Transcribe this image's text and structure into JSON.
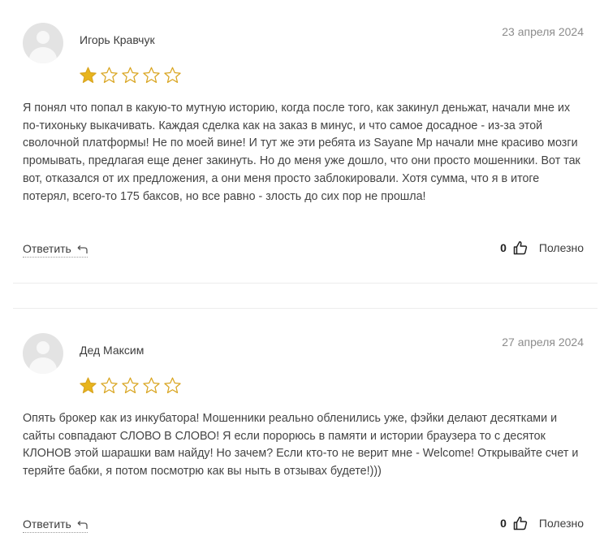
{
  "reviews": [
    {
      "author": "Игорь Кравчук",
      "date": "23 апреля 2024",
      "rating": 1,
      "max_rating": 5,
      "text": "Я понял что попал в какую-то мутную историю, когда после того, как закинул деньжат, начали мне их по-тихоньку выкачивать. Каждая сделка как на заказ в минус, и что самое досадное - из-за этой сволочной платформы! Не по моей вине! И тут же эти ребята из Sayane Mp начали мне красиво мозги промывать, предлагая еще денег закинуть. Но до меня уже дошло, что они просто мошенники. Вот так вот, отказался от их предложения, а они меня просто заблокировали. Хотя сумма, что я в итоге потерял, всего-то 175 баксов, но все равно - злость до сих пор не прошла!",
      "reply_label": "Ответить",
      "useful_count": "0",
      "useful_label": "Полезно"
    },
    {
      "author": "Дед Максим",
      "date": "27 апреля 2024",
      "rating": 1,
      "max_rating": 5,
      "text": "Опять брокер как из инкубатора! Мошенники реально обленились уже, фэйки делают десятками и сайты совпадают СЛОВО В СЛОВО! Я если порорюсь в памяти и истории браузера то с десяток КЛОНОВ этой шарашки вам найду! Но зачем? Если кто-то не верит мне - Welcome! Открывайте счет и теряйте бабки, я потом посмотрю как вы ныть в отзывах будете!)))",
      "reply_label": "Ответить",
      "useful_count": "0",
      "useful_label": "Полезно"
    }
  ],
  "colors": {
    "star_filled": "#e8b51c",
    "star_outline": "#d9a520",
    "avatar_bg": "#e3e3e3"
  },
  "icons": {
    "reply": "reply-arrow-icon",
    "useful": "thumbs-up-icon",
    "avatar": "user-placeholder-icon"
  }
}
